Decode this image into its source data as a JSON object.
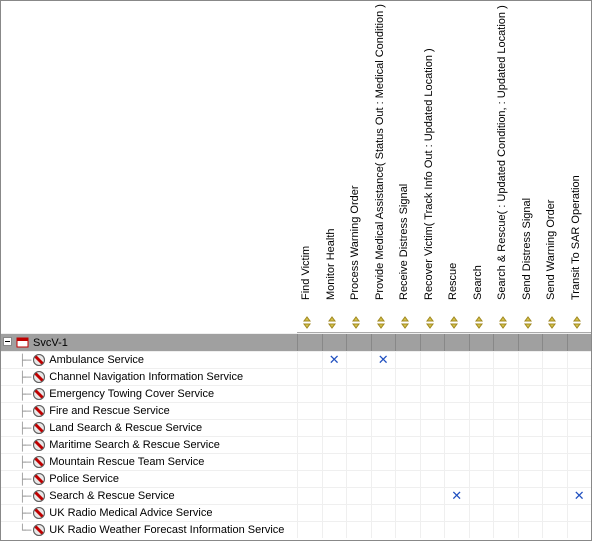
{
  "matrix_name": "SvcV-1",
  "columns": [
    {
      "label": "Find Victim"
    },
    {
      "label": "Monitor Health"
    },
    {
      "label": "Process Warning Order"
    },
    {
      "label": "Provide Medical Assistance( Status Out : Medical Condition )"
    },
    {
      "label": "Receive Distress Signal"
    },
    {
      "label": "Recover Victim( Track Info Out : Updated Location )"
    },
    {
      "label": "Rescue"
    },
    {
      "label": "Search"
    },
    {
      "label": "Search & Rescue(  : Updated Condition,  : Updated Location )"
    },
    {
      "label": "Send Distress Signal"
    },
    {
      "label": "Send Warning Order"
    },
    {
      "label": "Transit To SAR Operation"
    }
  ],
  "rows": [
    {
      "label": "Ambulance Service",
      "marks": [
        1,
        3
      ]
    },
    {
      "label": "Channel Navigation Information Service",
      "marks": []
    },
    {
      "label": "Emergency Towing Cover Service",
      "marks": []
    },
    {
      "label": "Fire and Rescue Service",
      "marks": []
    },
    {
      "label": "Land Search & Rescue Service",
      "marks": []
    },
    {
      "label": "Maritime Search & Rescue Service",
      "marks": []
    },
    {
      "label": "Mountain Rescue Team Service",
      "marks": []
    },
    {
      "label": "Police Service",
      "marks": []
    },
    {
      "label": "Search & Rescue Service",
      "marks": [
        6,
        11
      ]
    },
    {
      "label": "UK Radio Medical Advice Service",
      "marks": []
    },
    {
      "label": "UK Radio Weather Forecast Information Service",
      "marks": []
    }
  ],
  "mark_glyph": "✕"
}
